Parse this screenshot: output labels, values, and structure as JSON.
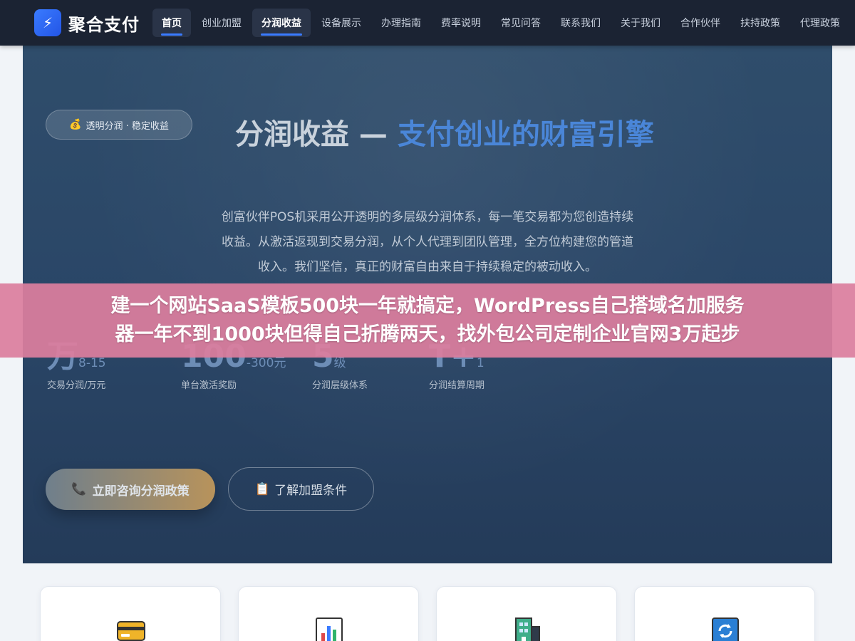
{
  "nav": {
    "logo_icon": "lightning-icon",
    "logo_text": "聚合支付",
    "items": [
      {
        "label": "首页",
        "active": true
      },
      {
        "label": "创业加盟",
        "active": false
      },
      {
        "label": "分润收益",
        "active": true
      },
      {
        "label": "设备展示",
        "active": false
      },
      {
        "label": "办理指南",
        "active": false
      },
      {
        "label": "费率说明",
        "active": false
      },
      {
        "label": "常见问答",
        "active": false
      },
      {
        "label": "联系我们",
        "active": false
      },
      {
        "label": "关于我们",
        "active": false
      },
      {
        "label": "合作伙伴",
        "active": false
      },
      {
        "label": "扶持政策",
        "active": false
      },
      {
        "label": "代理政策",
        "active": false
      }
    ]
  },
  "hero": {
    "badge_icon": "money-bag-icon",
    "badge_text": "透明分润 · 稳定收益",
    "title_main": "分润收益 — ",
    "title_accent": "支付创业的财富引擎",
    "desc_lines": [
      "创富伙伴POS机采用公开透明的多层级分润体系，每一笔交易都为您创造持续",
      "收益。从激活返现到交易分润，从个人代理到团队管理，全方位构建您的管道",
      "收入。我们坚信，真正的财富自由来自于持续稳定的被动收入。"
    ],
    "stats": [
      {
        "num": "万",
        "unit": "8-15",
        "label": "交易分润/万元"
      },
      {
        "num": "100",
        "unit": "-300元",
        "label": "单台激活奖励"
      },
      {
        "num": "5",
        "unit": "级",
        "label": "分润层级体系"
      },
      {
        "num": "T+",
        "unit": "1",
        "label": "分润结算周期"
      }
    ],
    "primary_button": "立即咨询分润政策",
    "primary_icon": "phone-icon",
    "secondary_button": "了解加盟条件",
    "secondary_icon": "clipboard-icon"
  },
  "ad_banner": {
    "line1": "建一个网站SaaS模板500块一年就搞定，WordPress自己搭域名加服务",
    "line2": "器一年不到1000块但得自己折腾两天，找外包公司定制企业官网3万起步"
  },
  "cards": [
    {
      "icon": "credit-card-icon"
    },
    {
      "icon": "bar-chart-icon"
    },
    {
      "icon": "building-icon"
    },
    {
      "icon": "refresh-icon"
    }
  ],
  "colors": {
    "nav_bg": "#1b2333",
    "accent": "#3a7bff",
    "hero_bg": "#2a4667",
    "ad_bg": "#db7e9e"
  }
}
